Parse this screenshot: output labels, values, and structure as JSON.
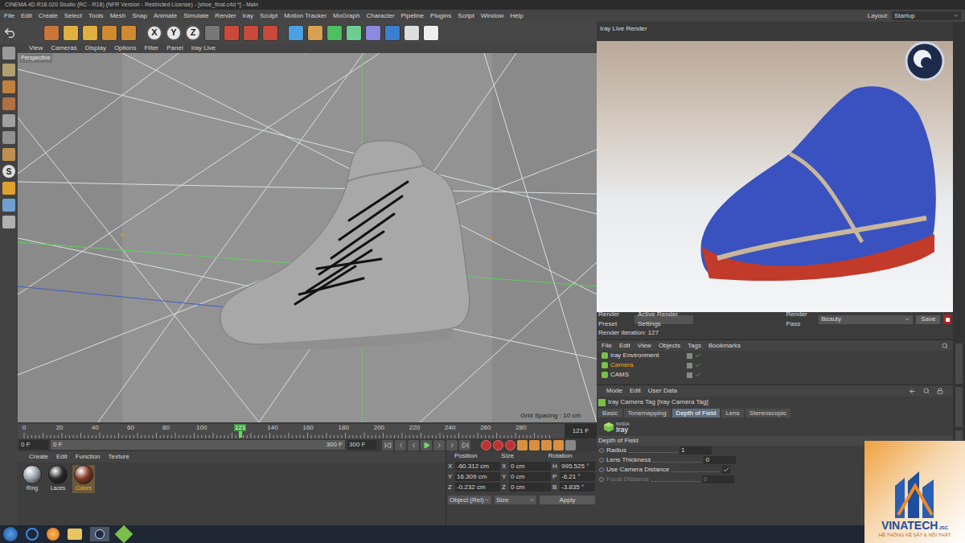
{
  "window": {
    "title": "CINEMA 4D R18.020 Studio (RC - R18) (NFR Version - Restricted License) - [shoe_final.c4d *] - Main"
  },
  "menu": [
    "File",
    "Edit",
    "Create",
    "Select",
    "Tools",
    "Mesh",
    "Snap",
    "Animate",
    "Simulate",
    "Render",
    "Iray",
    "Sculpt",
    "Motion Tracker",
    "MoGraph",
    "Character",
    "Pipeline",
    "Plugins",
    "Script",
    "Window",
    "Help"
  ],
  "layout": {
    "label": "Layout:",
    "value": "Startup"
  },
  "toolbar": {
    "axes": [
      "X",
      "Y",
      "Z"
    ]
  },
  "left_toolbar": {
    "snap": "S"
  },
  "viewport": {
    "menu": [
      "View",
      "Cameras",
      "Display",
      "Options",
      "Filter",
      "Panel",
      "Iray Live"
    ],
    "camera": "Perspective",
    "grid_spacing": "Grid Spacing : 10 cm"
  },
  "timeline": {
    "ticks": [
      "0",
      "20",
      "40",
      "60",
      "80",
      "100",
      "140",
      "160",
      "180",
      "200",
      "220",
      "240",
      "260",
      "280"
    ],
    "current": "121",
    "current_field": "121 F",
    "level": 0.4033
  },
  "playback": {
    "start": "0 F",
    "range_start": "0 F",
    "range_end": "300 F",
    "end": "300 F"
  },
  "materials": {
    "menu": [
      "Create",
      "Edit",
      "Function",
      "Texture"
    ],
    "items": [
      {
        "name": "Ring",
        "selected": false,
        "color": "#9aa3ad"
      },
      {
        "name": "Laces",
        "selected": false,
        "color": "#2a2a2a"
      },
      {
        "name": "Colors",
        "selected": true,
        "color": "#8a3a2a"
      }
    ]
  },
  "coordinates": {
    "headers": [
      "Position",
      "Size",
      "Rotation"
    ],
    "rows": [
      {
        "axis": "X",
        "position": "-60.312 cm",
        "size_axis": "X",
        "size": "0 cm",
        "rot_axis": "H",
        "rotation": "995.525 °"
      },
      {
        "axis": "Y",
        "position": "16.309 cm",
        "size_axis": "Y",
        "size": "0 cm",
        "rot_axis": "P",
        "rotation": "-6.21 °"
      },
      {
        "axis": "Z",
        "position": "-0.232 cm",
        "size_axis": "Z",
        "size": "0 cm",
        "rot_axis": "B",
        "rotation": "-3.835 °"
      }
    ],
    "mode": "Object (Rel)",
    "size_mode": "Size",
    "apply": "Apply"
  },
  "render": {
    "title": "Iray Live Render",
    "preset_label": "Render Preset",
    "preset": "Active Render Settings",
    "pass_label": "Render Pass",
    "pass": "Beauty",
    "save": "Save",
    "iteration": "Render Iteration: 127"
  },
  "objects": {
    "menu": [
      "File",
      "Edit",
      "View",
      "Objects",
      "Tags",
      "Bookmarks"
    ],
    "items": [
      {
        "name": "Iray Environment",
        "selected": false
      },
      {
        "name": "Camera",
        "selected": true
      },
      {
        "name": "CAMS",
        "selected": false
      }
    ]
  },
  "attributes": {
    "menu": [
      "Mode",
      "Edit",
      "User Data"
    ],
    "title": "Iray Camera Tag [Iray Camera Tag]",
    "tabs": [
      {
        "label": "Basic",
        "selected": false
      },
      {
        "label": "Tonemapping",
        "selected": false
      },
      {
        "label": "Depth of Field",
        "selected": true
      },
      {
        "label": "Lens",
        "selected": false
      },
      {
        "label": "Stereoscopic",
        "selected": false
      }
    ],
    "logo": {
      "brand": "NVIDIA.",
      "name": "Iray"
    },
    "section": "Depth of Field",
    "fields": [
      {
        "label": "Radius",
        "kind": "number",
        "value": "1",
        "disabled": false
      },
      {
        "label": "Lens Thickness",
        "kind": "number",
        "value": "0",
        "disabled": false
      },
      {
        "label": "Use Camera Distance",
        "kind": "checkbox",
        "checked": true,
        "disabled": false
      },
      {
        "label": "Focal Distance",
        "kind": "number",
        "value": "0",
        "disabled": true
      }
    ]
  },
  "watermark": {
    "name": "VINATECH",
    "suffix": "JSC",
    "tagline": "HỆ THỐNG KẾ SẮT & NỘI THẤT"
  }
}
